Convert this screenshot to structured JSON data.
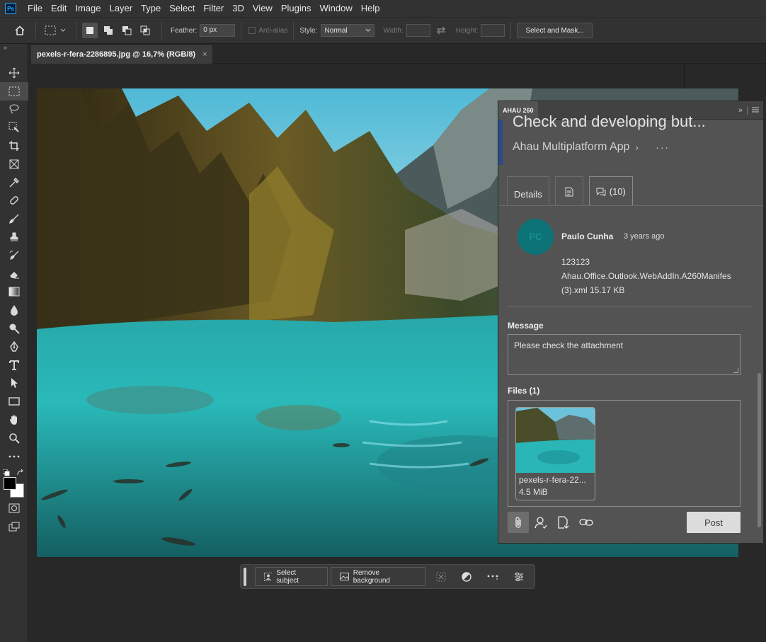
{
  "menu": {
    "logo": "Ps",
    "items": [
      "File",
      "Edit",
      "Image",
      "Layer",
      "Type",
      "Select",
      "Filter",
      "3D",
      "View",
      "Plugins",
      "Window",
      "Help"
    ]
  },
  "options": {
    "feather_label": "Feather:",
    "feather_value": "0 px",
    "antialias_label": "Anti-alias",
    "style_label": "Style:",
    "style_value": "Normal",
    "width_label": "Width:",
    "height_label": "Height:",
    "select_mask_label": "Select and Mask..."
  },
  "toolbar": {
    "collapse": "»",
    "tools": [
      "move-tool",
      "marquee-tool",
      "lasso-tool",
      "object-select-tool",
      "crop-tool",
      "frame-tool",
      "eyedropper-tool",
      "healing-tool",
      "brush-tool",
      "stamp-tool",
      "history-brush-tool",
      "eraser-tool",
      "gradient-tool",
      "blur-tool",
      "dodge-tool",
      "pen-tool",
      "type-tool",
      "path-select-tool",
      "rectangle-tool",
      "hand-tool",
      "zoom-tool",
      "more-tools"
    ]
  },
  "document": {
    "tab_title": "pexels-r-fera-2286895.jpg @ 16,7% (RGB/8)",
    "tab_close": "×"
  },
  "taskbar": {
    "select_subject": "Select subject",
    "remove_background": "Remove background"
  },
  "panel": {
    "tab_label": "AHAU 260",
    "collapse_icon": "»",
    "title": "Check and developing but...",
    "subtitle": "Ahau Multiplatform App",
    "chevron": "›",
    "more": "···",
    "tabs": {
      "details": "Details",
      "comments": "(10)"
    },
    "comment": {
      "avatar_initials": "PC",
      "author": "Paulo Cunha",
      "time": "3 years ago",
      "line1": "123123",
      "line2": "Ahau.Office.Outlook.WebAddIn.A260Manifes",
      "line3": "(3).xml 15.17 KB"
    },
    "message_label": "Message",
    "message_value": "Please check the attachment",
    "files_label": "Files (1)",
    "file": {
      "name": "pexels-r-fera-22...",
      "size": "4.5 MiB"
    },
    "post_label": "Post"
  },
  "colors": {
    "accent": "#2b4a8a",
    "avatar": "#0d7377"
  }
}
